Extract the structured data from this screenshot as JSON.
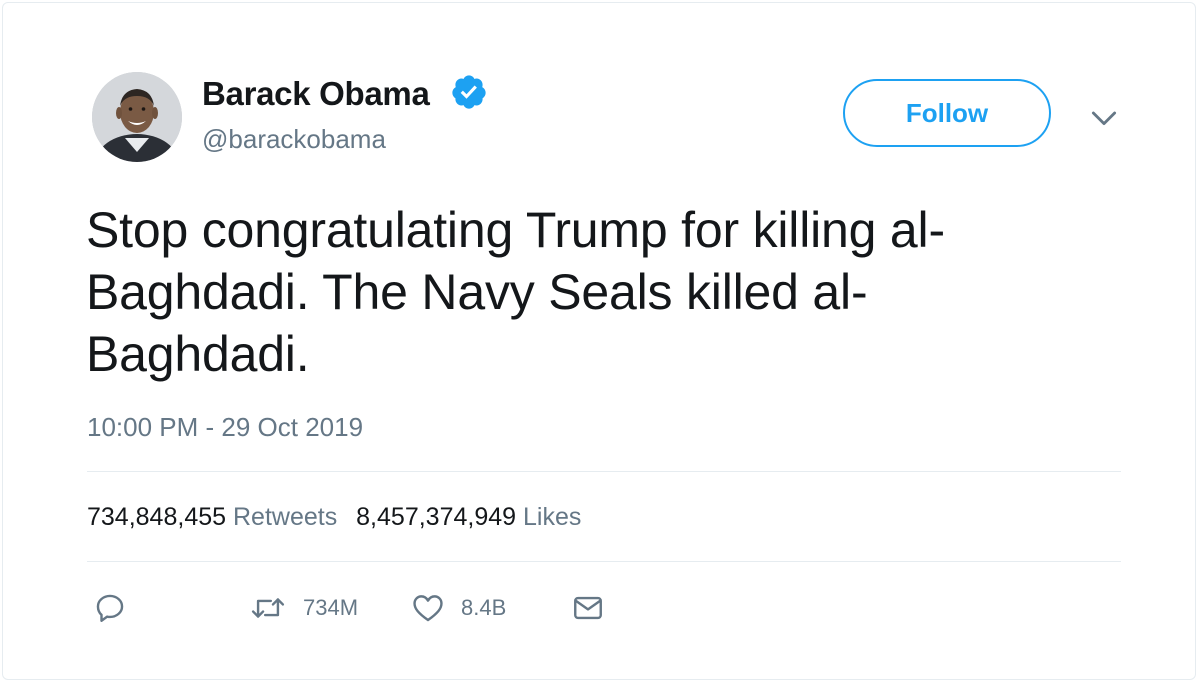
{
  "author": {
    "display_name": "Barack Obama",
    "handle": "@barackobama",
    "verified": true,
    "avatar_icon": "avatar-photo"
  },
  "header": {
    "follow_label": "Follow",
    "menu_icon": "chevron-down-icon"
  },
  "tweet": {
    "text": "Stop congratulating Trump for killing al-\nBaghdadi. The Navy Seals killed al-\nBaghdadi.",
    "timestamp": "10:00 PM - 29 Oct 2019"
  },
  "stats": {
    "retweets_count": "734,848,455",
    "retweets_label": "Retweets",
    "likes_count": "8,457,374,949",
    "likes_label": "Likes"
  },
  "actions": {
    "reply_icon": "reply-icon",
    "retweet_icon": "retweet-icon",
    "retweet_count": "734M",
    "like_icon": "heart-icon",
    "like_count": "8.4B",
    "dm_icon": "envelope-icon"
  },
  "colors": {
    "accent": "#1da1f2",
    "text_primary": "#14171a",
    "text_secondary": "#657786",
    "divider": "#e6ecf0"
  }
}
